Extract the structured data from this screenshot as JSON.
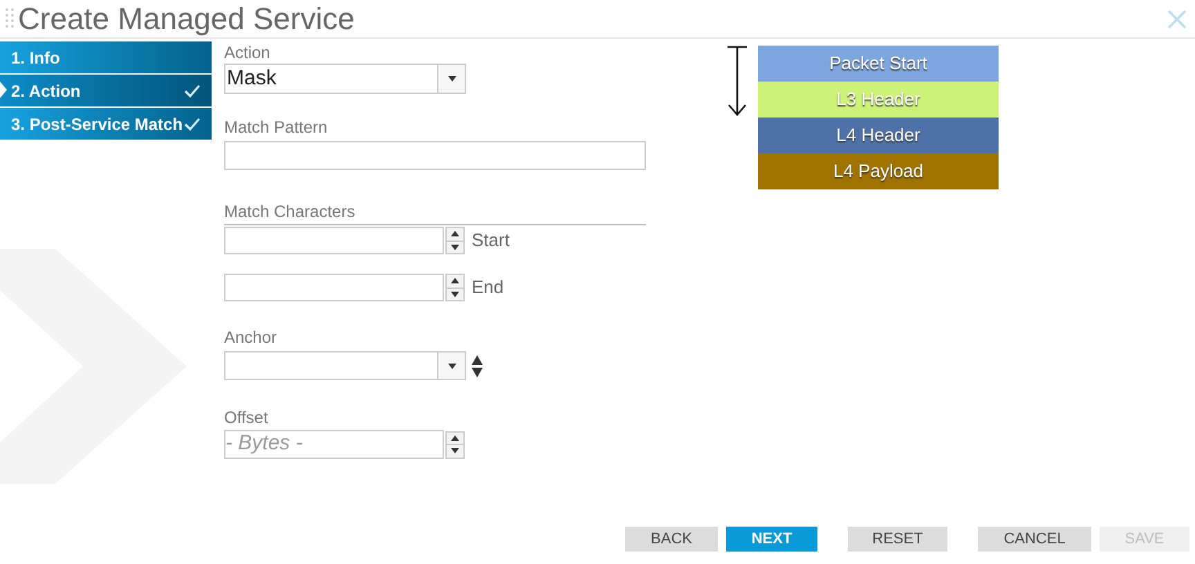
{
  "window": {
    "title": "Create Managed Service"
  },
  "steps": [
    {
      "label": "1. Info",
      "selected": false,
      "done": false
    },
    {
      "label": "2. Action",
      "selected": true,
      "done": true
    },
    {
      "label": "3. Post-Service Match",
      "selected": false,
      "done": true
    }
  ],
  "form": {
    "action": {
      "label": "Action",
      "value": "Mask"
    },
    "match_pattern": {
      "label": "Match Pattern"
    },
    "match_characters": {
      "label": "Match Characters",
      "start_label": "Start",
      "end_label": "End"
    },
    "anchor": {
      "label": "Anchor"
    },
    "offset": {
      "label": "Offset",
      "placeholder": "- Bytes -"
    }
  },
  "packet_diagram": [
    {
      "label": "Packet Start",
      "color": "#7ea6de"
    },
    {
      "label": "L3 Header",
      "color": "#ccf277"
    },
    {
      "label": "L4 Header",
      "color": "#4e72a8"
    },
    {
      "label": "L4 Payload",
      "color": "#a07300"
    }
  ],
  "button_groups": [
    [
      {
        "label": "BACK",
        "kind": "secondary",
        "disabled": false
      },
      {
        "label": "NEXT",
        "kind": "primary",
        "disabled": false
      }
    ],
    [
      {
        "label": "RESET",
        "kind": "secondary",
        "disabled": false
      }
    ],
    [
      {
        "label": "CANCEL",
        "kind": "secondary",
        "disabled": false
      },
      {
        "label": "SAVE",
        "kind": "secondary",
        "disabled": true
      }
    ]
  ]
}
